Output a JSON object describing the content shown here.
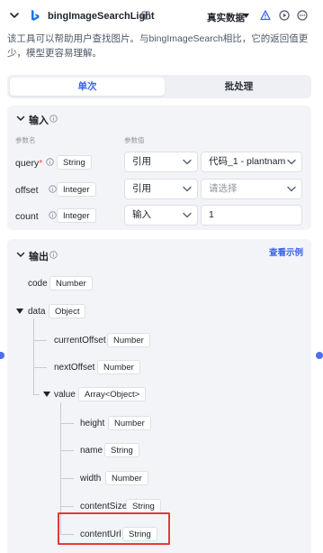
{
  "header": {
    "title": "bingImageSearchLight",
    "data_mode": "真实数据",
    "icons": {
      "collapse": "chevron-down-icon",
      "logo": "bing-logo-icon",
      "template": "template-icon",
      "warning": "warning-triangle-icon",
      "run": "play-circle-icon",
      "more": "more-circle-icon"
    }
  },
  "description": "该工具可以帮助用户查找图片。与bingImageSearch相比，它的返回值更少，模型更容易理解。",
  "tabs": [
    {
      "label": "单次",
      "active": true
    },
    {
      "label": "批处理",
      "active": false
    }
  ],
  "input": {
    "title": "输入",
    "col_name": "参数名",
    "col_value": "参数值",
    "params": [
      {
        "name": "query",
        "required": "*",
        "type": "String",
        "mode": "引用",
        "value": "代码_1 - plantnam",
        "placeholder": ""
      },
      {
        "name": "offset",
        "required": "",
        "type": "Integer",
        "mode": "引用",
        "value": "",
        "placeholder": "请选择"
      },
      {
        "name": "count",
        "required": "",
        "type": "Integer",
        "mode": "输入",
        "value": "1",
        "placeholder": ""
      }
    ]
  },
  "output": {
    "title": "输出",
    "view_example": "查看示例",
    "tree": [
      {
        "name": "code",
        "type": "Number"
      },
      {
        "name": "data",
        "type": "Object"
      },
      {
        "name": "currentOffset",
        "type": "Number"
      },
      {
        "name": "nextOffset",
        "type": "Number"
      },
      {
        "name": "value",
        "type": "Array<Object>"
      },
      {
        "name": "height",
        "type": "Number"
      },
      {
        "name": "name",
        "type": "String"
      },
      {
        "name": "width",
        "type": "Number"
      },
      {
        "name": "contentSize",
        "type": "String"
      },
      {
        "name": "contentUrl",
        "type": "String"
      }
    ]
  },
  "colors": {
    "accent": "#3b62f0",
    "highlight": "#e23b3b",
    "panel": "#f3f4f7"
  }
}
